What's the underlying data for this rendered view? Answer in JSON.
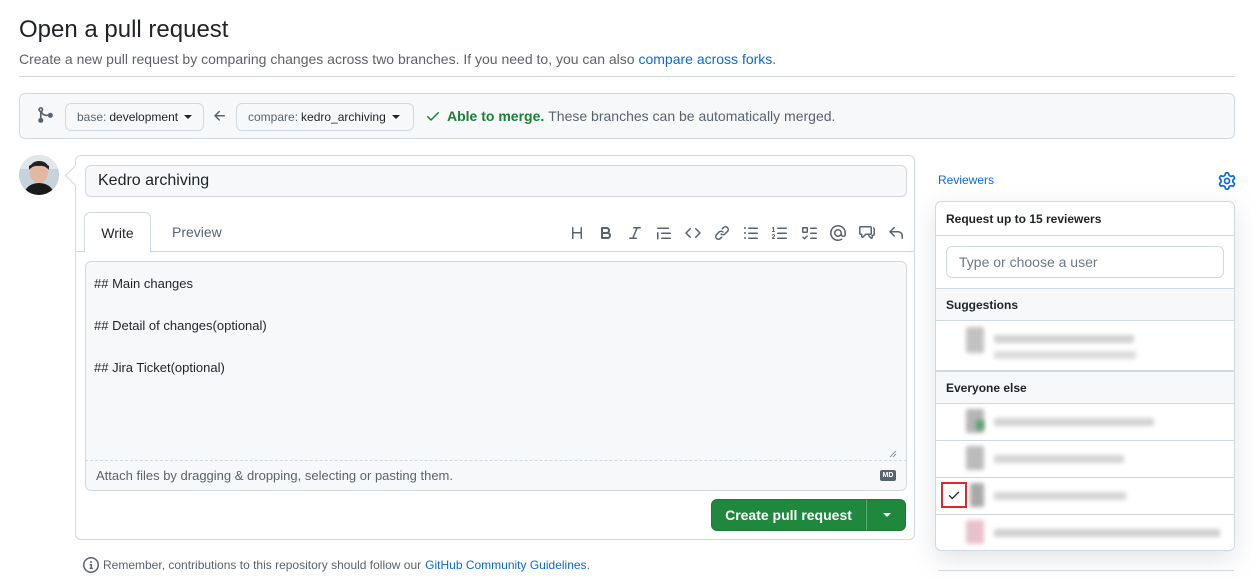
{
  "page": {
    "title": "Open a pull request",
    "subtitle": "Create a new pull request by comparing changes across two branches. If you need to, you can also ",
    "subtitle_link": "compare across forks",
    "subtitle_end": "."
  },
  "compare": {
    "base_prefix": "base:",
    "base_branch": "development",
    "compare_prefix": "compare:",
    "compare_branch": "kedro_archiving",
    "merge_status_bold": "Able to merge.",
    "merge_status_text": "These branches can be automatically merged."
  },
  "editor": {
    "title_value": "Kedro archiving",
    "tabs": {
      "write": "Write",
      "preview": "Preview"
    },
    "toolbar": [
      "heading-icon",
      "bold-icon",
      "italic-icon",
      "quote-icon",
      "code-icon",
      "link-icon",
      "unordered-list-icon",
      "ordered-list-icon",
      "task-list-icon",
      "mention-icon",
      "cross-reference-icon",
      "undo-icon"
    ],
    "body": "## Main changes\n\n## Detail of changes(optional)\n\n## Jira Ticket(optional)",
    "attach_hint": "Attach files by dragging & dropping, selecting or pasting them.",
    "markdown_badge": "MD"
  },
  "actions": {
    "create_label": "Create pull request"
  },
  "footer": {
    "guidelines_text": "Remember, contributions to this repository should follow our",
    "guidelines_link": "GitHub Community Guidelines",
    "guidelines_end": "."
  },
  "sidebar": {
    "reviewers_title": "Reviewers",
    "popover": {
      "header": "Request up to 15 reviewers",
      "search_placeholder": "Type or choose a user",
      "suggestions_label": "Suggestions",
      "everyone_label": "Everyone else"
    }
  },
  "colors": {
    "accent": "#0969da",
    "success": "#1a7f37",
    "primary_button": "#1f883d",
    "highlight_box": "#e5262b"
  }
}
